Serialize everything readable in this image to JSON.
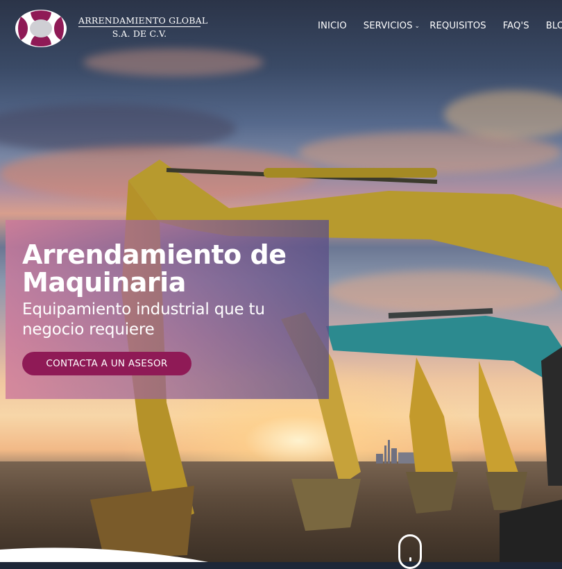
{
  "brand": {
    "name_line1": "ARRENDAMIENTO GLOBAL",
    "name_line2": "S.A. DE C.V.",
    "primary_color": "#8f1a56",
    "logo_icon": "globe-logo-icon"
  },
  "nav": {
    "items": [
      {
        "label": "INICIO"
      },
      {
        "label": "SERVICIOS",
        "has_dropdown": true
      },
      {
        "label": "REQUISITOS"
      },
      {
        "label": "FAQ'S"
      },
      {
        "label": "BLO"
      }
    ],
    "dropdown_icon": "chevron-down-icon"
  },
  "hero": {
    "title": "Arrendamiento de Maquinaria",
    "subtitle": "Equipamiento industrial que tu negocio requiere",
    "cta_label": "CONTACTA A UN ASESOR",
    "background": "excavators-sunset-photo"
  },
  "scroll_indicator_icon": "mouse-scroll-icon"
}
